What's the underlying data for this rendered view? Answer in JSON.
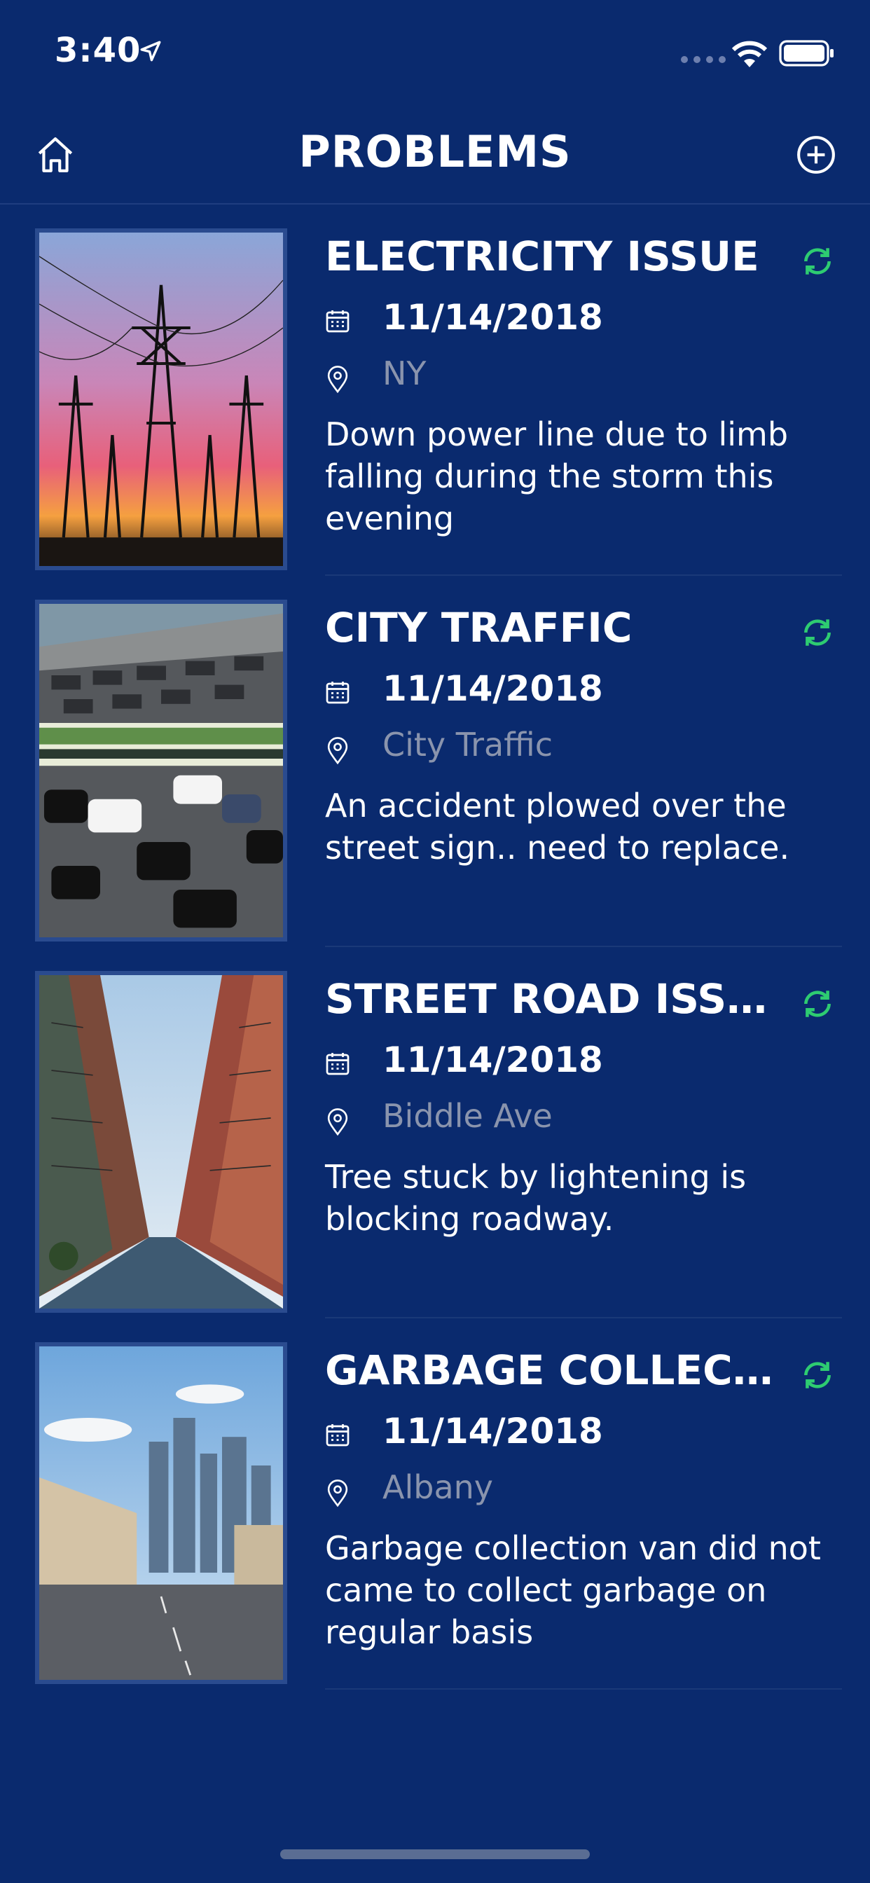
{
  "status_bar": {
    "time": "3:40"
  },
  "nav": {
    "title": "PROBLEMS"
  },
  "problems": [
    {
      "title": "ELECTRICITY ISSUE",
      "date": "11/14/2018",
      "location": "NY",
      "description": "Down power line due to limb falling during the storm this evening"
    },
    {
      "title": "CITY TRAFFIC",
      "date": "11/14/2018",
      "location": "City Traffic",
      "description": "An accident plowed over the street sign.. need to replace."
    },
    {
      "title": "STREET ROAD ISSUE",
      "date": "11/14/2018",
      "location": "Biddle Ave",
      "description": "Tree stuck by lightening is blocking roadway."
    },
    {
      "title": "GARBAGE COLLEC...",
      "date": "11/14/2018",
      "location": "Albany",
      "description": "Garbage collection van did not came to collect garbage on regular basis"
    }
  ],
  "colors": {
    "background": "#0a2a6e",
    "sync": "#2ecc71",
    "muted_text": "#8a94ad"
  }
}
